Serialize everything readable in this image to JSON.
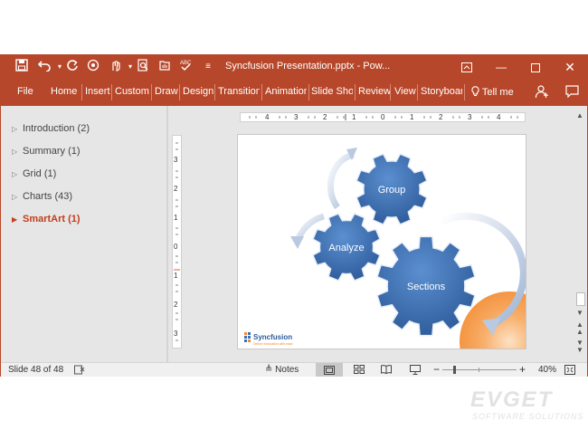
{
  "window": {
    "title": "Syncfusion Presentation.pptx  -  Pow...",
    "quick_access": [
      "save-icon",
      "undo-icon",
      "redo-icon",
      "repeat-icon",
      "touch-mode-icon",
      "print-preview-icon",
      "open-icon",
      "spelling-icon",
      "customize-icon"
    ]
  },
  "ribbon": {
    "tabs": [
      "File",
      "Home",
      "Insert",
      "Custom",
      "Draw",
      "Design",
      "Transition",
      "Animation",
      "Slide Show",
      "Review",
      "View",
      "Storyboar"
    ],
    "tell_me": "Tell me"
  },
  "outline": {
    "items": [
      {
        "label": "Introduction (2)",
        "active": false
      },
      {
        "label": "Summary (1)",
        "active": false
      },
      {
        "label": "Grid (1)",
        "active": false
      },
      {
        "label": "Charts (43)",
        "active": false
      },
      {
        "label": "SmartArt (1)",
        "active": true
      }
    ]
  },
  "ruler": {
    "h_labels": [
      "4",
      "3",
      "2",
      "1",
      "0",
      "1",
      "2",
      "3",
      "4"
    ],
    "v_labels": [
      "3",
      "2",
      "1",
      "0",
      "1",
      "2",
      "3"
    ]
  },
  "slide": {
    "gears": [
      "Group",
      "Analyze",
      "Sections"
    ],
    "logo_text": "Syncfusion",
    "logo_tagline": "Deliver innovation with ease",
    "colors": {
      "gear": "#3a6fb4",
      "accent": "#f28a2e"
    }
  },
  "status": {
    "slide_info": "Slide 48 of 48",
    "notes_label": "Notes",
    "zoom": "40%"
  },
  "watermark": {
    "brand": "EVGET",
    "sub": "SOFTWARE SOLUTIONS"
  },
  "theme": {
    "accent": "#b7472a",
    "active_item": "#c43e1c"
  }
}
